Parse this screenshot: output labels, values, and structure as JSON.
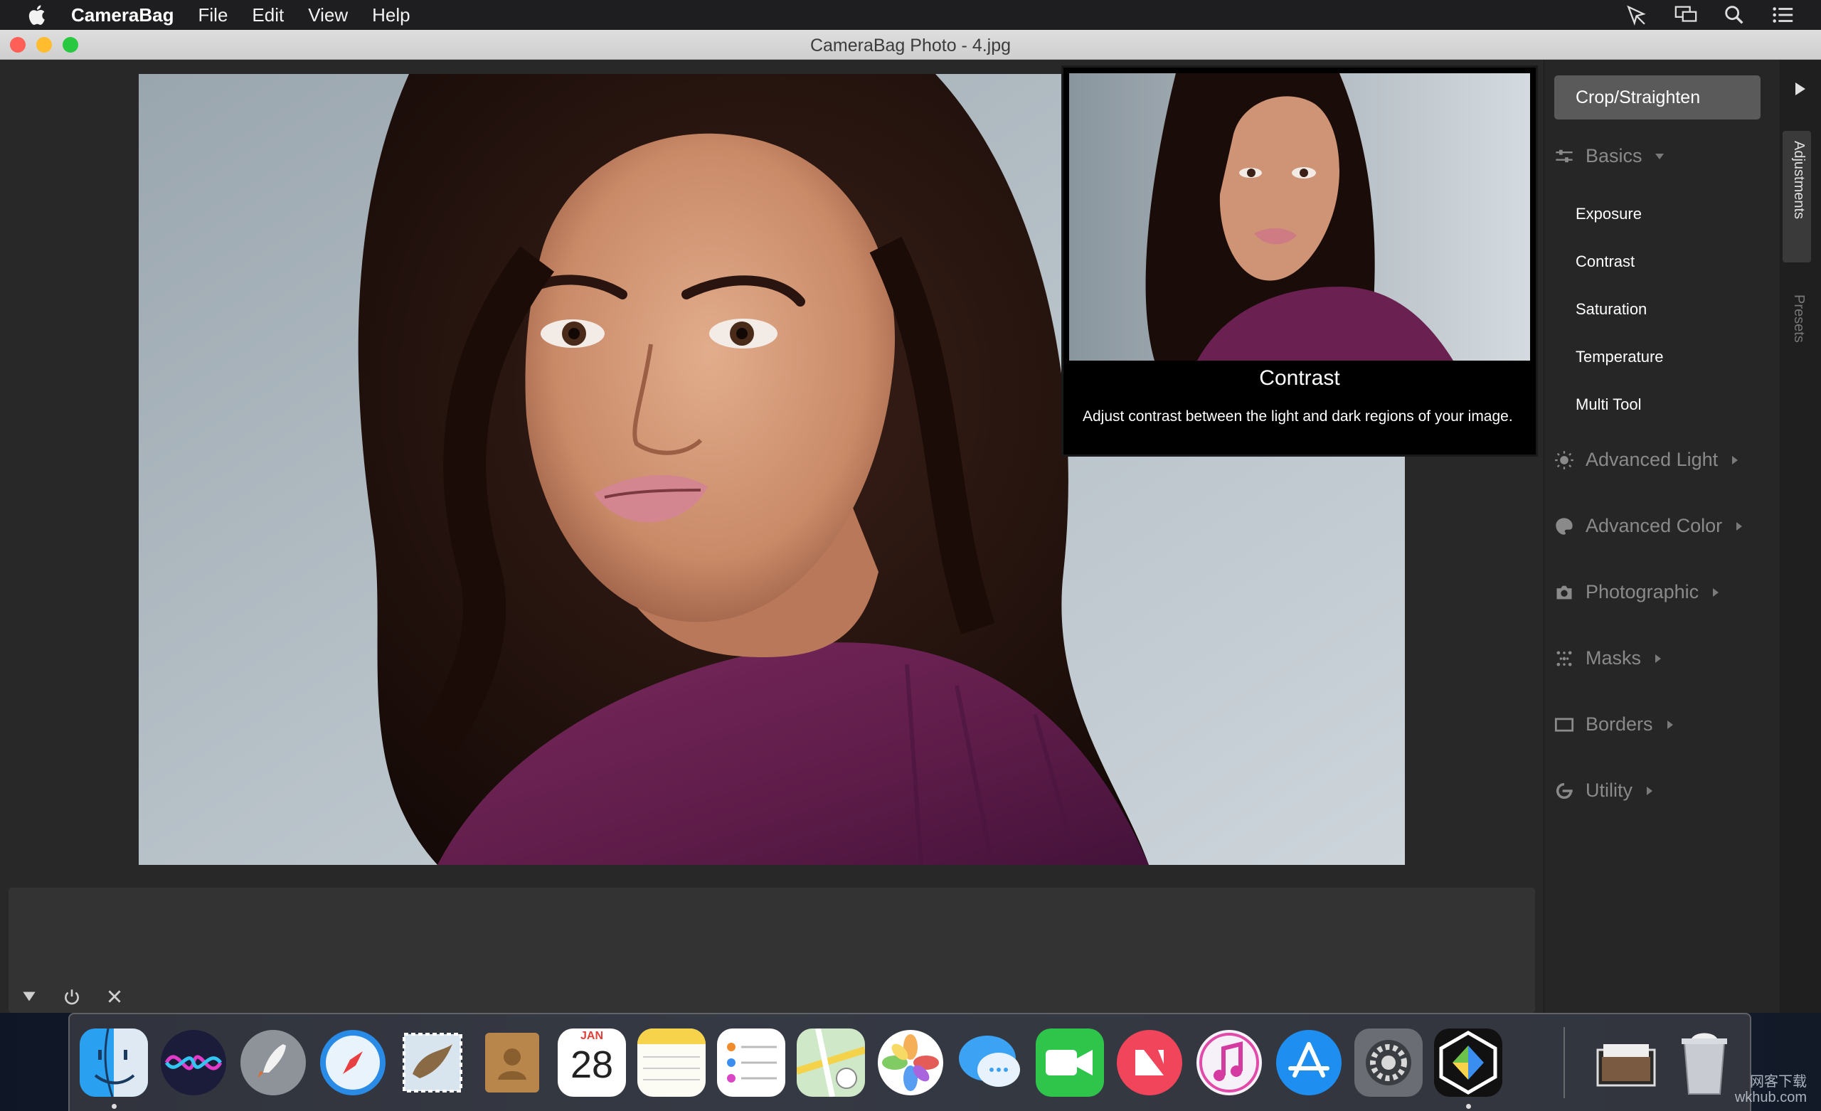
{
  "menubar": {
    "app_name": "CameraBag",
    "menus": [
      "File",
      "Edit",
      "View",
      "Help"
    ],
    "status_icons": [
      "airdrop-icon",
      "display-mirror-icon",
      "spotlight-search-icon",
      "notification-center-icon"
    ]
  },
  "window": {
    "title": "CameraBag Photo - 4.jpg",
    "controls": [
      "close",
      "minimize",
      "zoom"
    ],
    "colors": {
      "close": "#fe5f57",
      "minimize": "#febc2e",
      "zoom": "#28c840"
    }
  },
  "tooltip": {
    "title": "Contrast",
    "description": "Adjust contrast between the light and dark regions of your image."
  },
  "panel": {
    "crop_label": "Crop/Straighten",
    "basics": {
      "label": "Basics",
      "items": [
        "Exposure",
        "Contrast",
        "Saturation",
        "Temperature",
        "Multi Tool"
      ]
    },
    "sections": [
      {
        "label": "Advanced Light",
        "icon": "sun-icon"
      },
      {
        "label": "Advanced Color",
        "icon": "color-palette-icon"
      },
      {
        "label": "Photographic",
        "icon": "camera-icon"
      },
      {
        "label": "Masks",
        "icon": "mask-dots-icon"
      },
      {
        "label": "Borders",
        "icon": "border-frame-icon"
      },
      {
        "label": "Utility",
        "icon": "utility-icon"
      }
    ]
  },
  "sidetabs": {
    "adjustments": "Adjustments",
    "presets": "Presets"
  },
  "filmstrip": {
    "controls": [
      "collapse-icon",
      "power-icon",
      "close-icon"
    ]
  },
  "dock": {
    "apps": [
      "Finder",
      "Siri",
      "Launchpad",
      "Safari",
      "Mail",
      "Contacts",
      "Calendar",
      "Notes",
      "Reminders",
      "Maps",
      "Photos",
      "Messages",
      "FaceTime",
      "News",
      "iTunes",
      "App Store",
      "System Preferences",
      "CameraBag"
    ],
    "calendar_month": "JAN",
    "calendar_day": "28",
    "running": [
      "Finder",
      "CameraBag"
    ]
  },
  "watermark": {
    "line1": "网客下载",
    "line2": "wkhub.com"
  }
}
